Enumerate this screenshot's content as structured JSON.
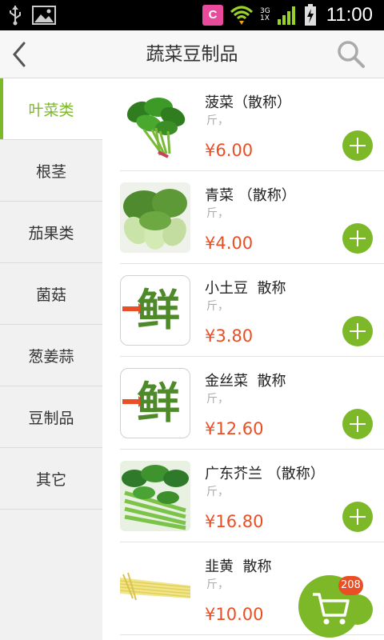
{
  "status_bar": {
    "time": "11:00",
    "app_icon_letter": "C",
    "network": "3G\n1X"
  },
  "header": {
    "title": "蔬菜豆制品",
    "back_icon": "chevron-left-icon",
    "search_icon": "search-icon"
  },
  "sidebar": {
    "items": [
      {
        "label": "叶菜类",
        "active": true
      },
      {
        "label": "根茎",
        "active": false
      },
      {
        "label": "茄果类",
        "active": false
      },
      {
        "label": "菌菇",
        "active": false
      },
      {
        "label": "葱姜蒜",
        "active": false
      },
      {
        "label": "豆制品",
        "active": false
      },
      {
        "label": "其它",
        "active": false
      }
    ]
  },
  "products": [
    {
      "name": "菠菜（散称）",
      "unit": "斤，",
      "price": "¥6.00",
      "image": "spinach"
    },
    {
      "name": "青菜 （散称）",
      "unit": "斤，",
      "price": "¥4.00",
      "image": "bok-choy"
    },
    {
      "name": "小土豆  散称",
      "unit": "斤，",
      "price": "¥3.80",
      "image": "xian-logo"
    },
    {
      "name": "金丝菜  散称",
      "unit": "斤，",
      "price": "¥12.60",
      "image": "xian-logo"
    },
    {
      "name": "广东芥兰 （散称）",
      "unit": "斤，",
      "price": "¥16.80",
      "image": "gai-lan"
    },
    {
      "name": "韭黄  散称",
      "unit": "斤，",
      "price": "¥10.00",
      "image": "yellow-chives"
    }
  ],
  "logo_text": "鲜",
  "cart": {
    "badge_count": "208",
    "minus_label": "-"
  },
  "colors": {
    "accent": "#7db829",
    "price": "#e94e24"
  }
}
